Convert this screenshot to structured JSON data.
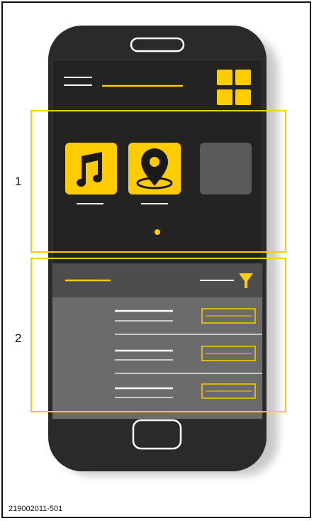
{
  "callouts": {
    "region_1": "1",
    "region_2": "2"
  },
  "document_id": "219002011-501",
  "colors": {
    "accent": "#ffcc00",
    "phone_body": "#2a2a2a",
    "screen_dark": "#232323",
    "panel_header": "#4d4d4d",
    "panel_body": "#6b6b6b",
    "placeholder_tile": "#5a5a5a",
    "callout_box": "#ffcc00"
  },
  "icons": {
    "menu": "hamburger-menu-icon",
    "grid": "app-grid-icon",
    "music": "music-note-icon",
    "location": "location-pin-icon",
    "filter": "filter-funnel-icon"
  }
}
